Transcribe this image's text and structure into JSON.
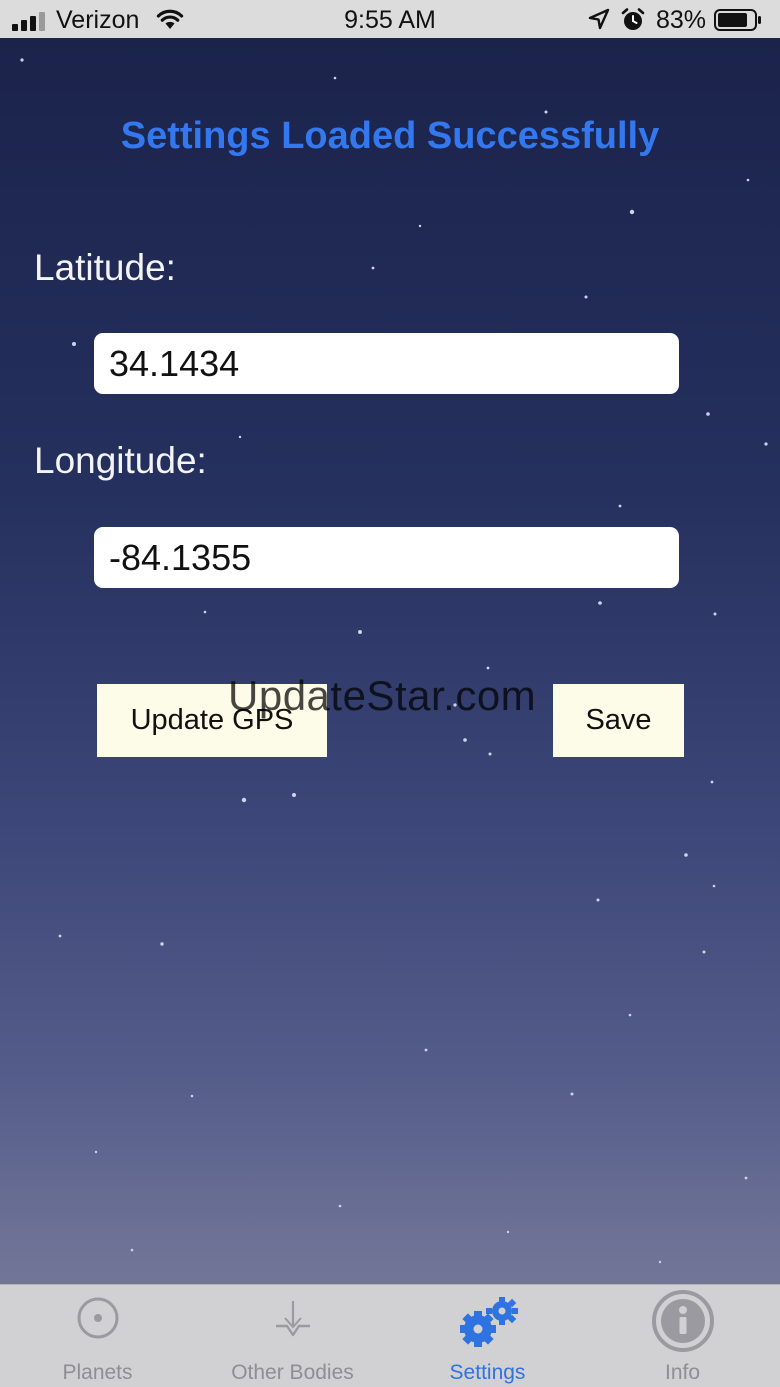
{
  "status_bar": {
    "carrier": "Verizon",
    "time": "9:55 AM",
    "battery_percent": "83%",
    "signal_bars_filled": 3,
    "signal_bars_total": 4,
    "battery_level": 0.83,
    "icons": [
      "signal-icon",
      "wifi-icon",
      "location-icon",
      "alarm-icon",
      "battery-icon"
    ]
  },
  "main": {
    "status_message": "Settings Loaded Successfully",
    "latitude": {
      "label": "Latitude:",
      "value": "34.1434"
    },
    "longitude": {
      "label": "Longitude:",
      "value": "-84.1355"
    },
    "buttons": {
      "update_gps": "Update GPS",
      "save": "Save"
    },
    "watermark": "UpdateStar.com"
  },
  "tab_bar": {
    "tabs": [
      {
        "label": "Planets",
        "icon": "planet-icon",
        "active": false
      },
      {
        "label": "Other Bodies",
        "icon": "other-bodies-icon",
        "active": false
      },
      {
        "label": "Settings",
        "icon": "gears-icon",
        "active": true
      },
      {
        "label": "Info",
        "icon": "info-icon",
        "active": false
      }
    ]
  },
  "colors": {
    "accent": "#3478f0",
    "active_tab": "#2f73e0",
    "inactive_tab": "#8e8e93",
    "button_bg": "#fcfce8",
    "background_top": "#1a2249",
    "background_bottom": "#7d7f98"
  }
}
